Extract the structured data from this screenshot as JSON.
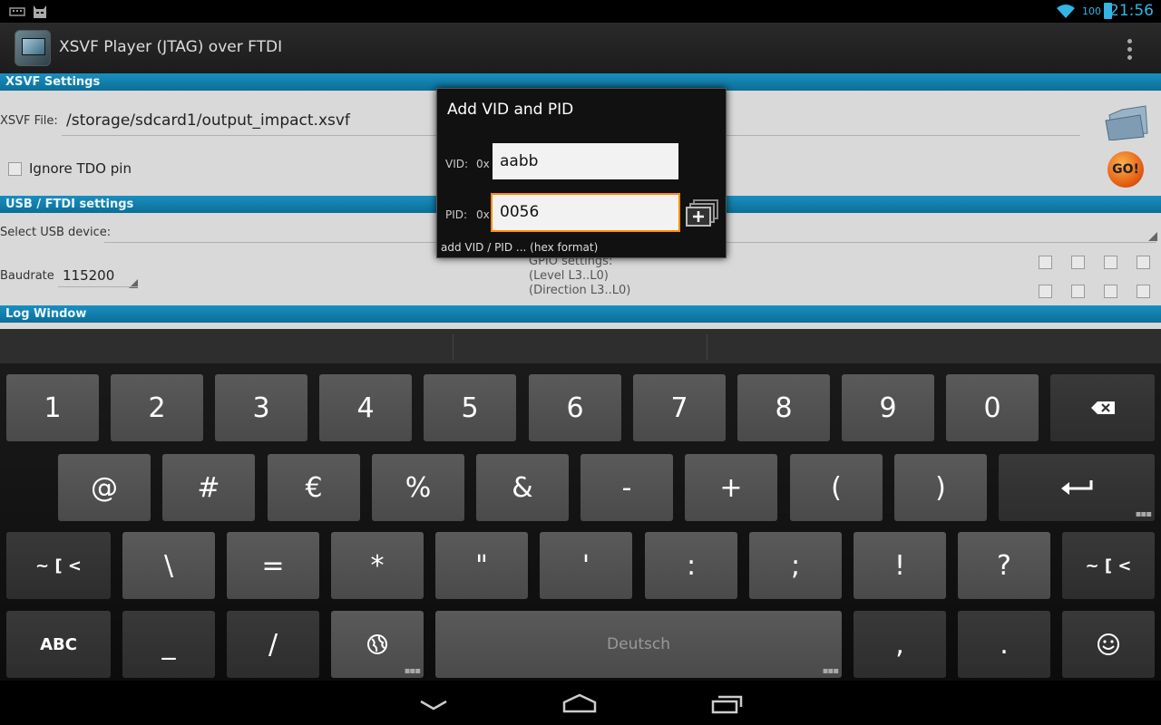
{
  "status": {
    "battery": "100",
    "time": "21:56"
  },
  "app": {
    "title": "XSVF Player (JTAG) over FTDI"
  },
  "sections": {
    "xsvf": "XSVF Settings",
    "usb": "USB / FTDI settings",
    "log": "Log Window"
  },
  "xsvf": {
    "file_label": "XSVF File:",
    "file_value": "/storage/sdcard1/output_impact.xsvf",
    "ignore_tdo_label": "Ignore TDO pin",
    "go_label": "GO!"
  },
  "usb": {
    "select_label": "Select USB device:",
    "baud_label": "Baudrate",
    "baud_value": "115200",
    "gpio_title": "GPIO settings:",
    "gpio_level": "(Level L3..L0)",
    "gpio_direction": "(Direction L3..L0)"
  },
  "dialog": {
    "title": "Add VID and PID",
    "vid_label": "VID:",
    "pid_label": "PID:",
    "prefix": "0x",
    "vid_value": "aabb",
    "pid_value": "0056",
    "hint": "add VID / PID ... (hex format)"
  },
  "keyboard": {
    "row1": [
      "1",
      "2",
      "3",
      "4",
      "5",
      "6",
      "7",
      "8",
      "9",
      "0"
    ],
    "row2": [
      "@",
      "#",
      "€",
      "%",
      "&",
      "-",
      "+",
      "(",
      ")"
    ],
    "row3_left": "~ [ <",
    "row3": [
      "\\",
      "=",
      "*",
      "\"",
      "'",
      ":",
      ";",
      "!",
      "?"
    ],
    "row3_right": "~ [ <",
    "abc": "ABC",
    "row4": [
      "_",
      "/"
    ],
    "space": "Deutsch",
    "comma": ",",
    "period": "."
  },
  "colors": {
    "accent": "#33b5e5",
    "section": "#0c7fb0",
    "focus": "#ff8c00"
  }
}
